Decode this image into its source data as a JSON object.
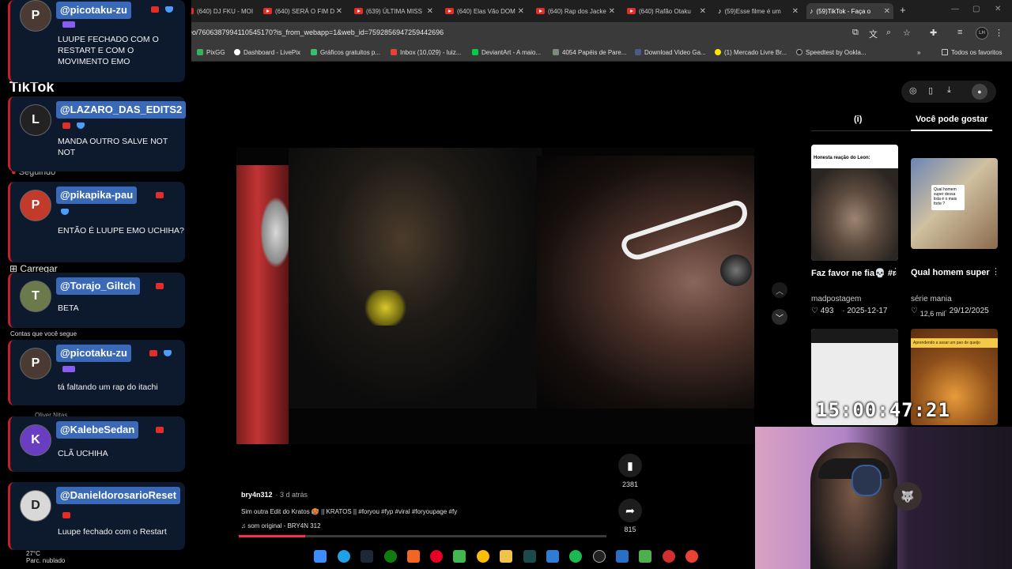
{
  "tabs": [
    {
      "label": "(640) DJ FKU - MOI",
      "kind": "yt"
    },
    {
      "label": "(640) SERÁ O FIM D",
      "kind": "yt"
    },
    {
      "label": "(639) ÚLTIMA MISS",
      "kind": "yt"
    },
    {
      "label": "(640) Elas Vão DOM",
      "kind": "yt"
    },
    {
      "label": "(640) Rap dos Jacke",
      "kind": "yt"
    },
    {
      "label": "(640) Rafão Otaku",
      "kind": "yt"
    },
    {
      "label": "(59)Esse filme é um",
      "kind": "tt"
    },
    {
      "label": "(59)TikTok - Faça o",
      "kind": "tt",
      "active": true
    }
  ],
  "address": {
    "url": "deo/7606387994110545170?is_from_webapp=1&web_id=7592856947259442696"
  },
  "bookmarks": [
    {
      "label": "PixGG",
      "color": "#38b35a"
    },
    {
      "label": "Dashboard - LivePix",
      "color": "#ffffff"
    },
    {
      "label": "Gráficos gratuitos p...",
      "color": "#37c06b"
    },
    {
      "label": "Inbox (10,029) - luiz...",
      "color": "#e94235"
    },
    {
      "label": "DeviantArt - A maio...",
      "color": "#05cc47"
    },
    {
      "label": "4054 Papéis de Pare...",
      "color": "#7c8a7c"
    },
    {
      "label": "Download Video Ga...",
      "color": "#4a5a8a"
    },
    {
      "label": "(1) Mercado Livre Br...",
      "color": "#ffe600"
    },
    {
      "label": "Speedtest by Ookla...",
      "color": "#222222"
    }
  ],
  "bookmarks_folder": "Todos os favoritos",
  "video": {
    "author": "bry4n312",
    "ago": "· 3 d atrás",
    "caption": "Sim outra Edit do Kratos 🥵 || KRATOS || #foryou #fyp #viral #foryoupage #fy",
    "music": "♫  som original - BRY4N 312",
    "progress": 0.18,
    "saves": "2381",
    "shares": "815"
  },
  "sidebar": {
    "tab_info": "(i)",
    "tab_like": "Você pode gostar",
    "cards": [
      {
        "thumb_text": "Honesta reação do Leon:",
        "title": "Faz favor ne fia💀 #residentevilme...",
        "user": "madpostagem",
        "likes": "493",
        "date": "2025-12-17"
      },
      {
        "thumb_text": "Qual homem super dessa lista é o mais forte ?",
        "title": "Qual homem super dessa lista é o...",
        "user": "série mania",
        "likes": "12,6 mil",
        "date": "29/12/2025"
      },
      {
        "thumb_text": ""
      },
      {
        "thumb_text": "Aprendendo a assar um pao de queijo"
      }
    ]
  },
  "clock": "15:00:47:21",
  "chat_bg_text": {
    "tiktok": "TikTok",
    "seguindo": "Seguindo",
    "carregar": "Carregar",
    "contas": "Contas que você segue",
    "oliver": "Oliver Nitas"
  },
  "chat": [
    {
      "user": "@picotaku-zu",
      "msg": "LUUPE FECHADO COM O RESTART E COM O MOVIMENTO EMO",
      "avatar": "P"
    },
    {
      "user": "@LAZARO_DAS_EDITS2",
      "msg": "MANDA OUTRO SALVE NOT NOT",
      "avatar": "L"
    },
    {
      "user": "@pikapika-pau",
      "msg": "ENTÃO É LUUPE EMO UCHIHA?",
      "avatar": "P"
    },
    {
      "user": "@Torajo_Giltch",
      "msg": "BETA",
      "avatar": "T"
    },
    {
      "user": "@picotaku-zu",
      "msg": "tá faltando um rap do itachi",
      "avatar": "P"
    },
    {
      "user": "@KalebeSedan",
      "msg": "CLÃ UCHIHA",
      "avatar": "K"
    },
    {
      "user": "@DanieldorosarioReset",
      "msg": "Luupe fechado com o Restart",
      "avatar": "D"
    }
  ],
  "weather": {
    "temp": "27°C",
    "desc": "Parc. nublado"
  },
  "colors": {
    "accent": "#fe2c55",
    "chat_name_bg": "#3a69b8",
    "chat_card_bg": "#0d1a2e",
    "yt_red": "#e52d27"
  }
}
